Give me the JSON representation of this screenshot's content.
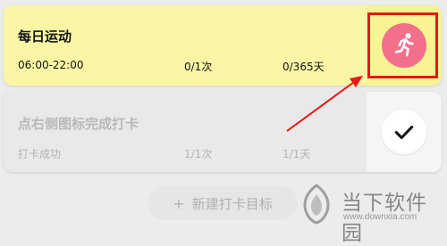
{
  "cards": [
    {
      "title": "每日运动",
      "time": "06:00-22:00",
      "count": "0/1次",
      "days": "0/365天",
      "action_icon": "running-person-icon",
      "action_color": "#f2708a"
    },
    {
      "title": "点右侧图标完成打卡",
      "status": "打卡成功",
      "count": "1/1次",
      "days": "1/1天",
      "action_icon": "checkmark-icon"
    }
  ],
  "new_goal": {
    "plus": "+",
    "label": "新建打卡目标"
  },
  "watermark": {
    "name": "当下软件园",
    "url": "www.downxia.com"
  },
  "colors": {
    "card_active_bg": "#fbf6a5",
    "card_done_bg": "#e9e9e9",
    "highlight": "#e61818"
  }
}
